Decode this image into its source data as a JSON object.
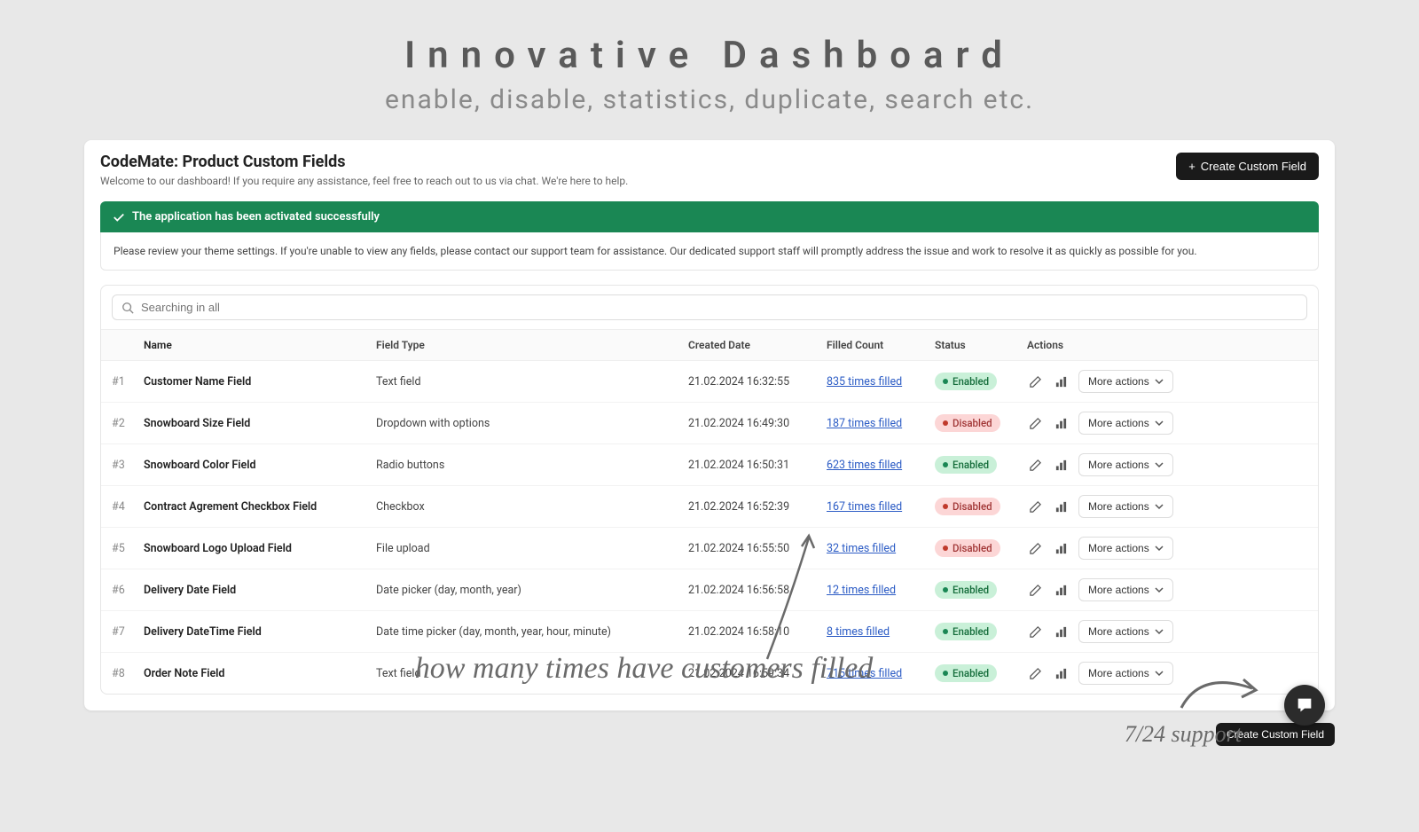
{
  "hero": {
    "title": "Innovative Dashboard",
    "subtitle": "enable, disable, statistics, duplicate, search etc."
  },
  "header": {
    "title": "CodeMate: Product Custom Fields",
    "welcome": "Welcome to our dashboard! If you require any assistance, feel free to reach out to us via chat. We're here to help.",
    "create_label": "Create Custom Field"
  },
  "alert": {
    "success": "The application has been activated successfully",
    "body": "Please review your theme settings. If you're unable to view any fields, please contact our support team for assistance. Our dedicated support staff will promptly address the issue and work to resolve it as quickly as possible for you."
  },
  "search": {
    "placeholder": "Searching in all"
  },
  "columns": {
    "name": "Name",
    "type": "Field Type",
    "date": "Created Date",
    "count": "Filled Count",
    "status": "Status",
    "actions": "Actions"
  },
  "status_labels": {
    "enabled": "Enabled",
    "disabled": "Disabled"
  },
  "more_actions_label": "More actions",
  "rows": [
    {
      "idx": "#1",
      "name": "Customer Name Field",
      "type": "Text field",
      "date": "21.02.2024 16:32:55",
      "count": "835 times filled",
      "status": "enabled"
    },
    {
      "idx": "#2",
      "name": "Snowboard Size Field",
      "type": "Dropdown with options",
      "date": "21.02.2024 16:49:30",
      "count": "187 times filled",
      "status": "disabled"
    },
    {
      "idx": "#3",
      "name": "Snowboard Color Field",
      "type": "Radio buttons",
      "date": "21.02.2024 16:50:31",
      "count": "623 times filled",
      "status": "enabled"
    },
    {
      "idx": "#4",
      "name": "Contract Agrement Checkbox Field",
      "type": "Checkbox",
      "date": "21.02.2024 16:52:39",
      "count": "167 times filled",
      "status": "disabled"
    },
    {
      "idx": "#5",
      "name": "Snowboard Logo Upload Field",
      "type": "File upload",
      "date": "21.02.2024 16:55:50",
      "count": "32 times filled",
      "status": "disabled"
    },
    {
      "idx": "#6",
      "name": "Delivery Date Field",
      "type": "Date picker (day, month, year)",
      "date": "21.02.2024 16:56:58",
      "count": "12 times filled",
      "status": "enabled"
    },
    {
      "idx": "#7",
      "name": "Delivery DateTime Field",
      "type": "Date time picker (day, month, year, hour, minute)",
      "date": "21.02.2024 16:58:10",
      "count": "8 times filled",
      "status": "enabled"
    },
    {
      "idx": "#8",
      "name": "Order Note Field",
      "type": "Text field",
      "date": "21.02.2024 16:59:34",
      "count": "715 times filled",
      "status": "enabled"
    }
  ],
  "footer": {
    "create_label": "Create Custom Field"
  },
  "annotations": {
    "filled": "how many times have customers filled",
    "support": "7/24 support"
  }
}
